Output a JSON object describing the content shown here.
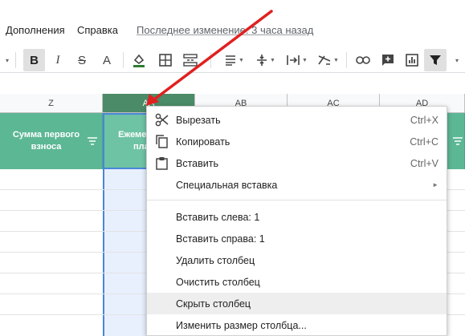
{
  "menu": {
    "addons": "Дополнения",
    "help": "Справка",
    "last_edit": "Последнее изменение: 3 часа назад"
  },
  "toolbar": {
    "icons": [
      "bold-icon",
      "italic-icon",
      "strikethrough-icon",
      "text-color-icon",
      "fill-color-icon",
      "borders-icon",
      "merge-icon",
      "align-icon",
      "valign-icon",
      "wrap-icon",
      "rotate-icon",
      "link-icon",
      "comment-icon",
      "chart-icon",
      "filter-icon"
    ],
    "bold": "B",
    "italic": "I",
    "strike": "S",
    "textcolor": "A"
  },
  "columns": [
    "Z",
    "AA",
    "AB",
    "AC",
    "AD"
  ],
  "header_cells": {
    "z": "Сумма первого взноса",
    "aa": "Ежемесячный платёж"
  },
  "context_menu": {
    "items": [
      {
        "label": "Вырезать",
        "shortcut": "Ctrl+X",
        "icon": "scissors-icon"
      },
      {
        "label": "Копировать",
        "shortcut": "Ctrl+C",
        "icon": "copy-icon"
      },
      {
        "label": "Вставить",
        "shortcut": "Ctrl+V",
        "icon": "paste-icon"
      },
      {
        "label": "Специальная вставка",
        "submenu": "►"
      },
      {
        "label": "Вставить слева: 1"
      },
      {
        "label": "Вставить справа: 1"
      },
      {
        "label": "Удалить столбец"
      },
      {
        "label": "Очистить столбец"
      },
      {
        "label": "Скрыть столбец"
      },
      {
        "label": "Изменить размер столбца..."
      }
    ]
  },
  "colors": {
    "header_green": "#5cb795",
    "selected_col": "#4b8b68",
    "selection_blue": "#4a86d9",
    "annotation_arrow": "#e02020"
  }
}
